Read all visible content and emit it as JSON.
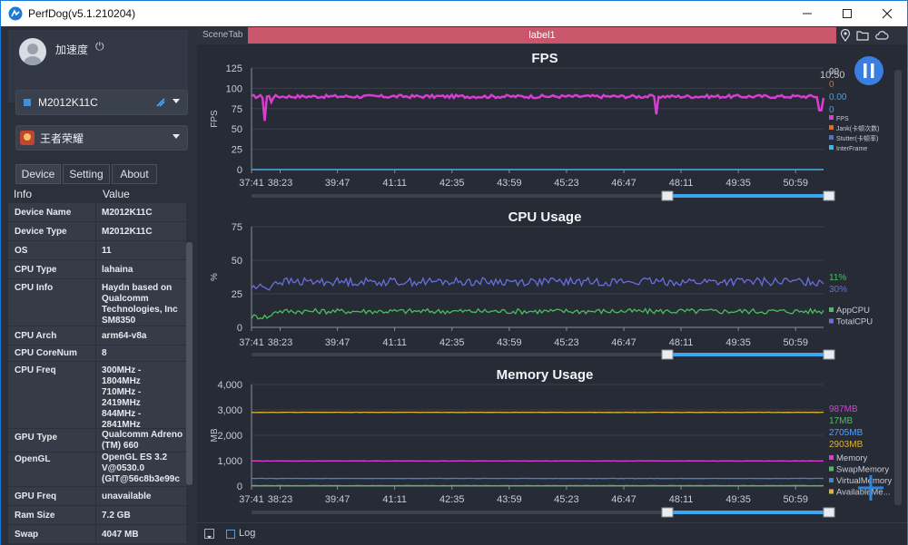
{
  "window": {
    "title": "PerfDog(v5.1.210204)"
  },
  "user": {
    "name": "加速度"
  },
  "device_select": {
    "value": "M2012K11C"
  },
  "app_select": {
    "value": "王者荣耀"
  },
  "tabs": [
    {
      "label": "Device"
    },
    {
      "label": "Setting"
    },
    {
      "label": "About"
    }
  ],
  "info": {
    "header": {
      "key": "Info",
      "value": "Value"
    },
    "rows": [
      {
        "key": "Device Name",
        "value": "M2012K11C"
      },
      {
        "key": "Device Type",
        "value": "M2012K11C"
      },
      {
        "key": "OS",
        "value": "11"
      },
      {
        "key": "CPU Type",
        "value": "lahaina"
      },
      {
        "key": "CPU Info",
        "value": "Haydn based on Qualcomm Technologies, Inc SM8350"
      },
      {
        "key": "CPU Arch",
        "value": "arm64-v8a"
      },
      {
        "key": "CPU CoreNum",
        "value": "8"
      },
      {
        "key": "CPU Freq",
        "value": "300MHz - 1804MHz 710MHz - 2419MHz 844MHz - 2841MHz"
      },
      {
        "key": "GPU Type",
        "value": "Qualcomm Adreno (TM) 660"
      },
      {
        "key": "OpenGL",
        "value": "OpenGL ES 3.2 V@0530.0 (GIT@56c8b3e99c"
      },
      {
        "key": "GPU Freq",
        "value": "unavailable"
      },
      {
        "key": "Ram Size",
        "value": "7.2 GB"
      },
      {
        "key": "Swap",
        "value": "4047 MB"
      }
    ]
  },
  "scene": {
    "tab_label": "SceneTab",
    "label": "label1"
  },
  "log": {
    "label": "Log"
  },
  "colors": {
    "accent": "#1e78d7",
    "label_bar": "#c9566a",
    "fps": "#d63fd0",
    "jank": "#e26b2a",
    "stutter": "#3a7bd5",
    "interframe": "#3cb7e6",
    "app_cpu": "#4bbf5a",
    "total_cpu": "#6a6ee0",
    "memory": "#d63fd0",
    "swap": "#4bbf5a",
    "virtual": "#3a86d8",
    "available": "#e0b430"
  },
  "chart_data": [
    {
      "type": "line",
      "title": "FPS",
      "ylabel": "FPS",
      "ylim": [
        0,
        125
      ],
      "yticks": [
        "0",
        "25",
        "50",
        "75",
        "100",
        "125"
      ],
      "xticks": [
        "37:41",
        "38:23",
        "39:47",
        "41:11",
        "42:35",
        "43:59",
        "45:23",
        "46:47",
        "48:11",
        "49:35",
        "50:59"
      ],
      "x_range": [
        "37:41",
        "51:40"
      ],
      "current_time": "10:50",
      "series": [
        {
          "name": "FPS",
          "current": "90",
          "approx_value": 90,
          "dips": [
            {
              "x": "38:00",
              "y": 60
            },
            {
              "x": "38:10",
              "y": 83
            },
            {
              "x": "47:35",
              "y": 68
            },
            {
              "x": "51:35",
              "y": 73
            }
          ]
        },
        {
          "name": "Jank(卡顿次数)",
          "current": "0",
          "approx_value": 0
        },
        {
          "name": "Stutter(卡顿率)",
          "current": "0.00",
          "approx_value": 0
        },
        {
          "name": "InterFrame",
          "current": "0",
          "approx_value": 0
        }
      ]
    },
    {
      "type": "line",
      "title": "CPU Usage",
      "ylabel": "%",
      "ylim": [
        0,
        75
      ],
      "yticks": [
        "0",
        "25",
        "50",
        "75"
      ],
      "xticks": [
        "37:41",
        "38:23",
        "39:47",
        "41:11",
        "42:35",
        "43:59",
        "45:23",
        "46:47",
        "48:11",
        "49:35",
        "50:59"
      ],
      "series": [
        {
          "name": "AppCPU",
          "current": "11%",
          "approx_value": 12
        },
        {
          "name": "TotalCPU",
          "current": "30%",
          "approx_value": 34
        }
      ]
    },
    {
      "type": "line",
      "title": "Memory Usage",
      "ylabel": "MB",
      "ylim": [
        0,
        4000
      ],
      "yticks": [
        "0",
        "1,000",
        "2,000",
        "3,000",
        "4,000"
      ],
      "xticks": [
        "37:41",
        "38:23",
        "39:47",
        "41:11",
        "42:35",
        "43:59",
        "45:23",
        "46:47",
        "48:11",
        "49:35",
        "50:59"
      ],
      "series": [
        {
          "name": "Memory",
          "current": "987MB",
          "approx_value": 987
        },
        {
          "name": "SwapMemory",
          "current": "17MB",
          "approx_value": 17
        },
        {
          "name": "VirtualMemory",
          "current": "2705MB",
          "approx_value": 300
        },
        {
          "name": "AvailableMe...",
          "current": "2903MB",
          "approx_value": 2903
        }
      ]
    }
  ]
}
